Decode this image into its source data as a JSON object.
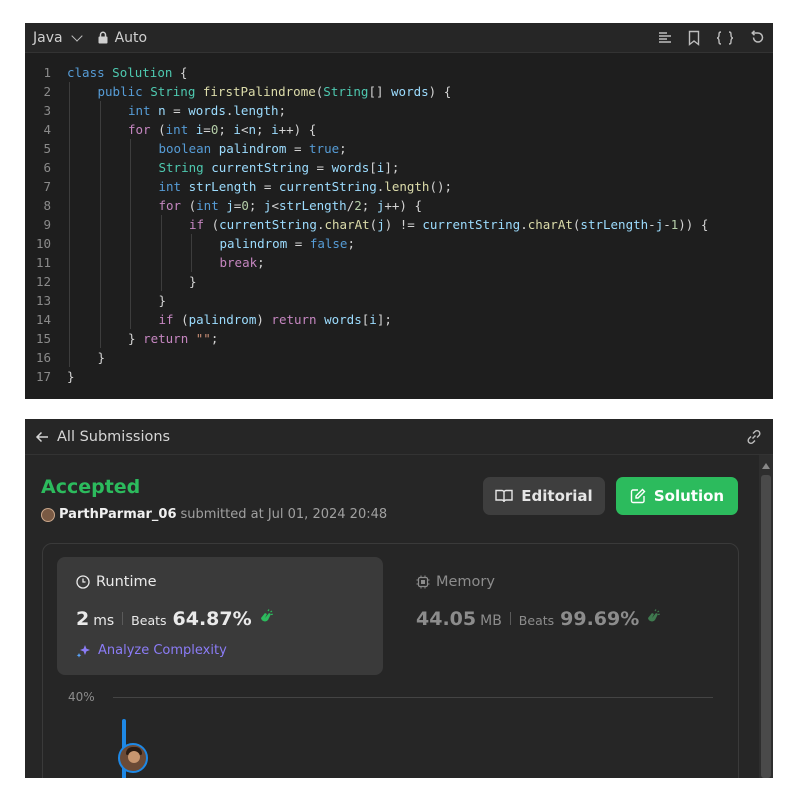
{
  "editor": {
    "language": "Java",
    "mode": "Auto",
    "tool_icons": [
      "format-icon",
      "bookmark-icon",
      "braces-icon",
      "reset-icon"
    ],
    "lines": [
      {
        "n": "1",
        "indent": 0,
        "tokens": [
          [
            "kw",
            "class"
          ],
          [
            "p",
            " "
          ],
          [
            "ty",
            "Solution"
          ],
          [
            "p",
            " {"
          ]
        ]
      },
      {
        "n": "2",
        "indent": 1,
        "tokens": [
          [
            "kw",
            "public"
          ],
          [
            "p",
            " "
          ],
          [
            "ty",
            "String"
          ],
          [
            "p",
            " "
          ],
          [
            "fn",
            "firstPalindrome"
          ],
          [
            "p",
            "("
          ],
          [
            "ty",
            "String"
          ],
          [
            "p",
            "[] "
          ],
          [
            "var",
            "words"
          ],
          [
            "p",
            ") {"
          ]
        ]
      },
      {
        "n": "3",
        "indent": 2,
        "tokens": [
          [
            "kw",
            "int"
          ],
          [
            "p",
            " "
          ],
          [
            "var",
            "n"
          ],
          [
            "p",
            " = "
          ],
          [
            "var",
            "words"
          ],
          [
            "p",
            "."
          ],
          [
            "var",
            "length"
          ],
          [
            "p",
            ";"
          ]
        ]
      },
      {
        "n": "4",
        "indent": 2,
        "tokens": [
          [
            "ctl",
            "for"
          ],
          [
            "p",
            " ("
          ],
          [
            "kw",
            "int"
          ],
          [
            "p",
            " "
          ],
          [
            "var",
            "i"
          ],
          [
            "p",
            "="
          ],
          [
            "num",
            "0"
          ],
          [
            "p",
            "; "
          ],
          [
            "var",
            "i"
          ],
          [
            "p",
            "<"
          ],
          [
            "var",
            "n"
          ],
          [
            "p",
            "; "
          ],
          [
            "var",
            "i"
          ],
          [
            "p",
            "++) {"
          ]
        ]
      },
      {
        "n": "5",
        "indent": 3,
        "tokens": [
          [
            "kw",
            "boolean"
          ],
          [
            "p",
            " "
          ],
          [
            "var",
            "palindrom"
          ],
          [
            "p",
            " = "
          ],
          [
            "kw",
            "true"
          ],
          [
            "p",
            ";"
          ]
        ]
      },
      {
        "n": "6",
        "indent": 3,
        "tokens": [
          [
            "ty",
            "String"
          ],
          [
            "p",
            " "
          ],
          [
            "var",
            "currentString"
          ],
          [
            "p",
            " = "
          ],
          [
            "var",
            "words"
          ],
          [
            "p",
            "["
          ],
          [
            "var",
            "i"
          ],
          [
            "p",
            "];"
          ]
        ]
      },
      {
        "n": "7",
        "indent": 3,
        "tokens": [
          [
            "kw",
            "int"
          ],
          [
            "p",
            " "
          ],
          [
            "var",
            "strLength"
          ],
          [
            "p",
            " = "
          ],
          [
            "var",
            "currentString"
          ],
          [
            "p",
            "."
          ],
          [
            "fn",
            "length"
          ],
          [
            "p",
            "();"
          ]
        ]
      },
      {
        "n": "8",
        "indent": 3,
        "tokens": [
          [
            "ctl",
            "for"
          ],
          [
            "p",
            " ("
          ],
          [
            "kw",
            "int"
          ],
          [
            "p",
            " "
          ],
          [
            "var",
            "j"
          ],
          [
            "p",
            "="
          ],
          [
            "num",
            "0"
          ],
          [
            "p",
            "; "
          ],
          [
            "var",
            "j"
          ],
          [
            "p",
            "<"
          ],
          [
            "var",
            "strLength"
          ],
          [
            "p",
            "/"
          ],
          [
            "num",
            "2"
          ],
          [
            "p",
            "; "
          ],
          [
            "var",
            "j"
          ],
          [
            "p",
            "++) {"
          ]
        ]
      },
      {
        "n": "9",
        "indent": 4,
        "tokens": [
          [
            "ctl",
            "if"
          ],
          [
            "p",
            " ("
          ],
          [
            "var",
            "currentString"
          ],
          [
            "p",
            "."
          ],
          [
            "fn",
            "charAt"
          ],
          [
            "p",
            "("
          ],
          [
            "var",
            "j"
          ],
          [
            "p",
            ") != "
          ],
          [
            "var",
            "currentString"
          ],
          [
            "p",
            "."
          ],
          [
            "fn",
            "charAt"
          ],
          [
            "p",
            "("
          ],
          [
            "var",
            "strLength"
          ],
          [
            "p",
            "-"
          ],
          [
            "var",
            "j"
          ],
          [
            "p",
            "-"
          ],
          [
            "num",
            "1"
          ],
          [
            "p",
            ")) {"
          ]
        ]
      },
      {
        "n": "10",
        "indent": 5,
        "tokens": [
          [
            "var",
            "palindrom"
          ],
          [
            "p",
            " = "
          ],
          [
            "kw",
            "false"
          ],
          [
            "p",
            ";"
          ]
        ]
      },
      {
        "n": "11",
        "indent": 5,
        "tokens": [
          [
            "ctl",
            "break"
          ],
          [
            "p",
            ";"
          ]
        ]
      },
      {
        "n": "12",
        "indent": 4,
        "tokens": [
          [
            "p",
            "}"
          ]
        ]
      },
      {
        "n": "13",
        "indent": 3,
        "tokens": [
          [
            "p",
            "}"
          ]
        ]
      },
      {
        "n": "14",
        "indent": 3,
        "tokens": [
          [
            "ctl",
            "if"
          ],
          [
            "p",
            " ("
          ],
          [
            "var",
            "palindrom"
          ],
          [
            "p",
            ") "
          ],
          [
            "ctl",
            "return"
          ],
          [
            "p",
            " "
          ],
          [
            "var",
            "words"
          ],
          [
            "p",
            "["
          ],
          [
            "var",
            "i"
          ],
          [
            "p",
            "];"
          ]
        ]
      },
      {
        "n": "15",
        "indent": 2,
        "tokens": [
          [
            "p",
            "} "
          ],
          [
            "ctl",
            "return"
          ],
          [
            "p",
            " "
          ],
          [
            "str",
            "\"\""
          ],
          [
            "p",
            ";"
          ]
        ]
      },
      {
        "n": "16",
        "indent": 1,
        "tokens": [
          [
            "p",
            "}"
          ]
        ]
      },
      {
        "n": "17",
        "indent": 0,
        "tokens": [
          [
            "p",
            "}"
          ]
        ]
      }
    ]
  },
  "submission": {
    "back_label": "All Submissions",
    "status": "Accepted",
    "username": "ParthParmar_06",
    "submitted_text": "submitted at Jul 01, 2024 20:48",
    "editorial_label": "Editorial",
    "solution_label": "Solution",
    "runtime": {
      "title": "Runtime",
      "value": "2",
      "unit": "ms",
      "beats_label": "Beats",
      "beats_pct": "64.87%",
      "analyze_label": "Analyze Complexity"
    },
    "memory": {
      "title": "Memory",
      "value": "44.05",
      "unit": "MB",
      "beats_label": "Beats",
      "beats_pct": "99.69%"
    },
    "chart_axis_label": "40%"
  },
  "colors": {
    "accepted": "#2cbb5d",
    "solution_button": "#2cbb5d",
    "analyze": "#8b7cf6",
    "chart_bar": "#1e88e5"
  }
}
